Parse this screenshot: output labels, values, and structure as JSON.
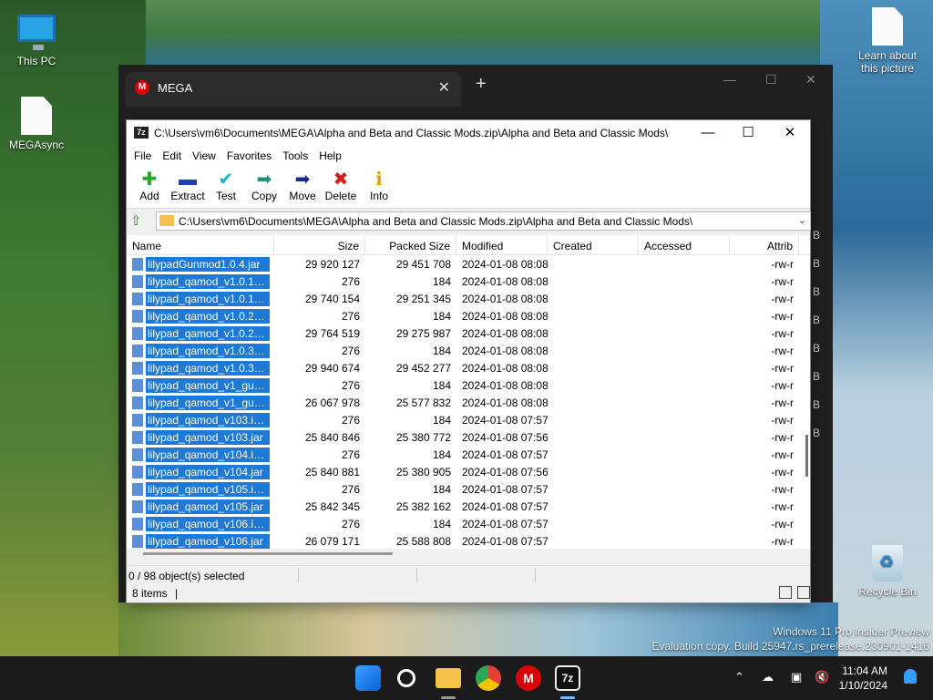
{
  "desktop": {
    "icons": [
      {
        "label": "This PC"
      },
      {
        "label": "MEGAsync"
      },
      {
        "label": "Learn about this picture"
      },
      {
        "label": "Recycle Bin"
      }
    ],
    "watermark_line1": "Windows 11 Pro Insider Preview",
    "watermark_line2": "Evaluation copy. Build 25947.rs_prerelease.230901-1416"
  },
  "mega": {
    "tab_title": "MEGA",
    "logo_letter": "M",
    "new_tab": "+",
    "close_tab": "✕",
    "side_letters": [
      "B",
      "B",
      "B",
      "B",
      "B",
      "B",
      "B",
      "B"
    ]
  },
  "zip": {
    "title": "C:\\Users\\vm6\\Documents\\MEGA\\Alpha and Beta and Classic Mods.zip\\Alpha and Beta and Classic Mods\\",
    "menu": [
      "File",
      "Edit",
      "View",
      "Favorites",
      "Tools",
      "Help"
    ],
    "toolbar": [
      {
        "label": "Add",
        "icon": "plus-icon",
        "glyph": "✚",
        "color": "#22aa22"
      },
      {
        "label": "Extract",
        "icon": "minus-icon",
        "glyph": "▬",
        "color": "#1a3fb0"
      },
      {
        "label": "Test",
        "icon": "check-icon",
        "glyph": "✔",
        "color": "#19b6c8"
      },
      {
        "label": "Copy",
        "icon": "copy-arrow-icon",
        "glyph": "➡",
        "color": "#1f8f80"
      },
      {
        "label": "Move",
        "icon": "move-arrow-icon",
        "glyph": "➡",
        "color": "#1a2a90"
      },
      {
        "label": "Delete",
        "icon": "delete-x-icon",
        "glyph": "✖",
        "color": "#d01c1c"
      },
      {
        "label": "Info",
        "icon": "info-icon",
        "glyph": "ℹ",
        "color": "#e0a000"
      }
    ],
    "address": "C:\\Users\\vm6\\Documents\\MEGA\\Alpha and Beta and Classic Mods.zip\\Alpha and Beta and Classic Mods\\",
    "columns": [
      "Name",
      "Size",
      "Packed Size",
      "Modified",
      "Created",
      "Accessed",
      "Attrib"
    ],
    "rows": [
      {
        "name": "lilypadGunmod1.0.4.jar",
        "size": "29 920 127",
        "packed": "29 451 708",
        "modified": "2024-01-08 08:08",
        "attr": "-rw-r"
      },
      {
        "name": "lilypad_qamod_v1.0.1_g...",
        "size": "276",
        "packed": "184",
        "modified": "2024-01-08 08:08",
        "attr": "-rw-r"
      },
      {
        "name": "lilypad_qamod_v1.0.1_g...",
        "size": "29 740 154",
        "packed": "29 251 345",
        "modified": "2024-01-08 08:08",
        "attr": "-rw-r"
      },
      {
        "name": "lilypad_qamod_v1.0.2_g...",
        "size": "276",
        "packed": "184",
        "modified": "2024-01-08 08:08",
        "attr": "-rw-r"
      },
      {
        "name": "lilypad_qamod_v1.0.2_g...",
        "size": "29 764 519",
        "packed": "29 275 987",
        "modified": "2024-01-08 08:08",
        "attr": "-rw-r"
      },
      {
        "name": "lilypad_qamod_v1.0.3_g...",
        "size": "276",
        "packed": "184",
        "modified": "2024-01-08 08:08",
        "attr": "-rw-r"
      },
      {
        "name": "lilypad_qamod_v1.0.3_g...",
        "size": "29 940 674",
        "packed": "29 452 277",
        "modified": "2024-01-08 08:08",
        "attr": "-rw-r"
      },
      {
        "name": "lilypad_qamod_v1_gun...",
        "size": "276",
        "packed": "184",
        "modified": "2024-01-08 08:08",
        "attr": "-rw-r"
      },
      {
        "name": "lilypad_qamod_v1_gun...",
        "size": "26 067 978",
        "packed": "25 577 832",
        "modified": "2024-01-08 08:08",
        "attr": "-rw-r"
      },
      {
        "name": "lilypad_qamod_v103.info",
        "size": "276",
        "packed": "184",
        "modified": "2024-01-08 07:57",
        "attr": "-rw-r"
      },
      {
        "name": "lilypad_qamod_v103.jar",
        "size": "25 840 846",
        "packed": "25 380 772",
        "modified": "2024-01-08 07:56",
        "attr": "-rw-r"
      },
      {
        "name": "lilypad_qamod_v104.info",
        "size": "276",
        "packed": "184",
        "modified": "2024-01-08 07:57",
        "attr": "-rw-r"
      },
      {
        "name": "lilypad_qamod_v104.jar",
        "size": "25 840 881",
        "packed": "25 380 905",
        "modified": "2024-01-08 07:56",
        "attr": "-rw-r"
      },
      {
        "name": "lilypad_qamod_v105.info",
        "size": "276",
        "packed": "184",
        "modified": "2024-01-08 07:57",
        "attr": "-rw-r"
      },
      {
        "name": "lilypad_qamod_v105.jar",
        "size": "25 842 345",
        "packed": "25 382 162",
        "modified": "2024-01-08 07:57",
        "attr": "-rw-r"
      },
      {
        "name": "lilypad_qamod_v106.info",
        "size": "276",
        "packed": "184",
        "modified": "2024-01-08 07:57",
        "attr": "-rw-r"
      },
      {
        "name": "lilypad_qamod_v106.jar",
        "size": "26 079 171",
        "packed": "25 588 808",
        "modified": "2024-01-08 07:57",
        "attr": "-rw-r"
      }
    ],
    "status_selected": "0 / 98 object(s) selected",
    "status_items": "8 items",
    "status_caret": "|"
  },
  "taskbar": {
    "time": "11:04 AM",
    "date": "1/10/2024",
    "mega_letter": "M",
    "zip_label": "7z"
  }
}
